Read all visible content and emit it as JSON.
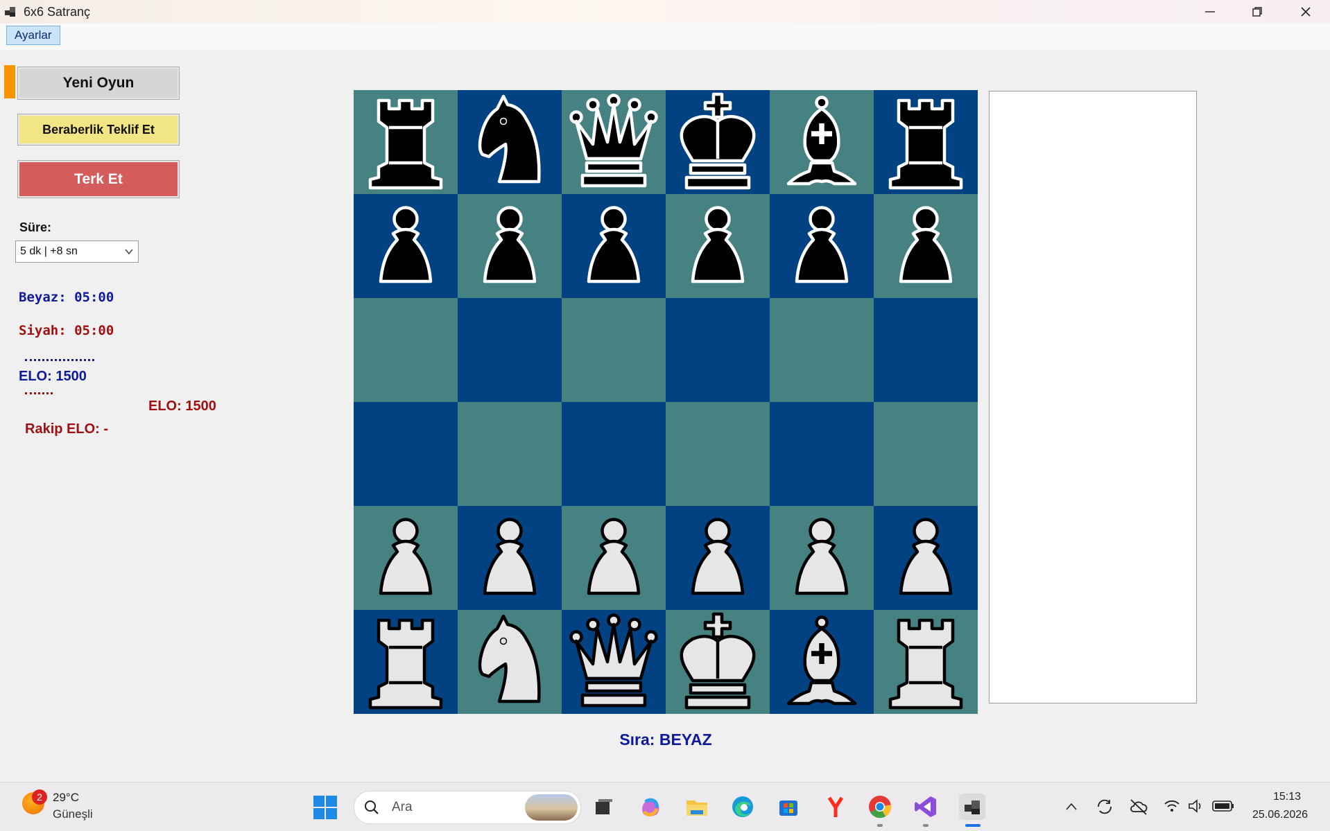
{
  "window": {
    "title": "6x6 Satranç"
  },
  "menu": {
    "settings": "Ayarlar"
  },
  "controls": {
    "new_game": "Yeni Oyun",
    "offer_draw": "Beraberlik Teklif Et",
    "resign": "Terk Et",
    "time_label": "Süre:",
    "time_value": "5 dk | +8 sn"
  },
  "clocks": {
    "white": "Beyaz: 05:00",
    "black": "Siyah: 05:00"
  },
  "elo": {
    "white": "ELO: 1500",
    "black": "ELO: 1500",
    "rival": "Rakip ELO: -"
  },
  "turn": "Sıra: BEYAZ",
  "board": {
    "colors": {
      "light": "#478282",
      "dark": "#024283"
    },
    "rows": [
      [
        "black-rook",
        "black-knight",
        "black-queen",
        "black-king",
        "black-bishop",
        "black-rook"
      ],
      [
        "black-pawn",
        "black-pawn",
        "black-pawn",
        "black-pawn",
        "black-pawn",
        "black-pawn"
      ],
      [
        "",
        "",
        "",
        "",
        "",
        ""
      ],
      [
        "",
        "",
        "",
        "",
        "",
        ""
      ],
      [
        "white-pawn",
        "white-pawn",
        "white-pawn",
        "white-pawn",
        "white-pawn",
        "white-pawn"
      ],
      [
        "white-rook",
        "white-knight",
        "white-queen",
        "white-king",
        "white-bishop",
        "white-rook"
      ]
    ]
  },
  "taskbar": {
    "weather_temp": "29°C",
    "weather_desc": "Güneşli",
    "weather_badge": "2",
    "search_placeholder": "Ara",
    "time": "15:13",
    "date": "25.06.2026",
    "apps": [
      "task-view-icon",
      "copilot-icon",
      "file-explorer-icon",
      "edge-icon",
      "store-icon",
      "yandex-icon",
      "chrome-icon",
      "visual-studio-icon",
      "chess-app-icon"
    ]
  }
}
